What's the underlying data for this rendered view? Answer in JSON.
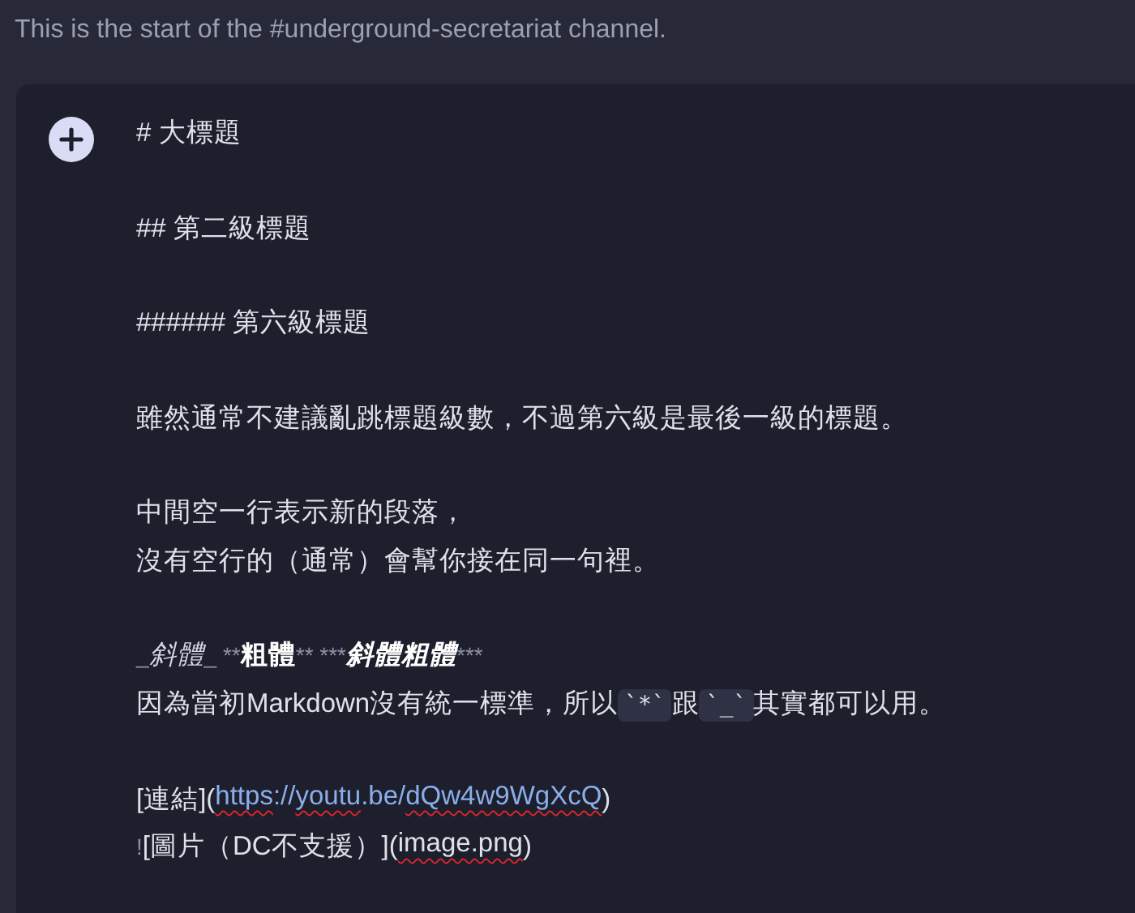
{
  "channel_intro": "This is the start of the #underground-secretariat channel.",
  "composer": {
    "paragraphs": [
      [
        {
          "segments": [
            {
              "kind": "plain",
              "text": "# 大標題"
            }
          ]
        }
      ],
      [
        {
          "segments": [
            {
              "kind": "plain",
              "text": "## 第二級標題"
            }
          ]
        }
      ],
      [
        {
          "segments": [
            {
              "kind": "plain",
              "text": "###### 第六級標題"
            }
          ]
        }
      ],
      [
        {
          "segments": [
            {
              "kind": "plain",
              "text": "雖然通常不建議亂跳標題級數，不過第六級是最後一級的標題。"
            }
          ]
        }
      ],
      [
        {
          "segments": [
            {
              "kind": "plain",
              "text": "中間空一行表示新的段落，"
            }
          ]
        },
        {
          "segments": [
            {
              "kind": "plain",
              "text": "沒有空行的（通常）會幫你接在同一句裡。"
            }
          ]
        }
      ],
      [
        {
          "segments": [
            {
              "kind": "marker",
              "text": "_"
            },
            {
              "kind": "italic",
              "text": "斜體"
            },
            {
              "kind": "marker",
              "text": "_ **"
            },
            {
              "kind": "bold",
              "text": "粗體"
            },
            {
              "kind": "marker",
              "text": "** ***"
            },
            {
              "kind": "bolditalic",
              "text": "斜體粗體"
            },
            {
              "kind": "marker",
              "text": "***"
            }
          ]
        },
        {
          "segments": [
            {
              "kind": "plain",
              "text": "因為當初Markdown沒有統一標準，所以"
            },
            {
              "kind": "code",
              "text": "`*`"
            },
            {
              "kind": "plain",
              "text": "跟"
            },
            {
              "kind": "code",
              "text": "`_`"
            },
            {
              "kind": "plain",
              "text": "其實都可以用。"
            }
          ]
        }
      ],
      [
        {
          "segments": [
            {
              "kind": "plain",
              "text": "[連結]("
            },
            {
              "kind": "link",
              "parts": [
                {
                  "text": "https",
                  "misspelled": true
                },
                {
                  "text": "://",
                  "misspelled": false
                },
                {
                  "text": "youtu",
                  "misspelled": true
                },
                {
                  "text": ".be/",
                  "misspelled": false
                },
                {
                  "text": "dQw4w9WgXcQ",
                  "misspelled": true
                }
              ]
            },
            {
              "kind": "plain",
              "text": ")"
            }
          ]
        },
        {
          "segments": [
            {
              "kind": "marker",
              "text": "!"
            },
            {
              "kind": "plain",
              "text": "[圖片（DC不支援）]("
            },
            {
              "kind": "plain",
              "text": "image.png",
              "misspelled": true
            },
            {
              "kind": "plain",
              "text": ")"
            }
          ]
        }
      ]
    ]
  }
}
